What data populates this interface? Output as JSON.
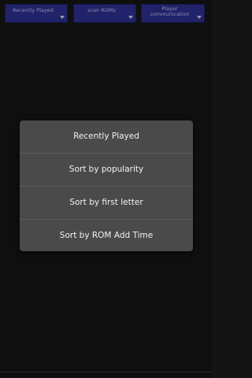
{
  "toolbar": {
    "dropdowns": [
      {
        "label": "Recently Played"
      },
      {
        "label": "scan ROMs"
      },
      {
        "label": "Player communication"
      }
    ]
  },
  "dialog": {
    "options": [
      {
        "label": "Recently Played"
      },
      {
        "label": "Sort by popularity"
      },
      {
        "label": "Sort by first letter"
      },
      {
        "label": "Sort by ROM Add Time"
      }
    ]
  },
  "colors": {
    "dropdown_bg": "#2b2f8c",
    "dialog_bg": "#4a4a4a",
    "page_bg": "#141414"
  }
}
